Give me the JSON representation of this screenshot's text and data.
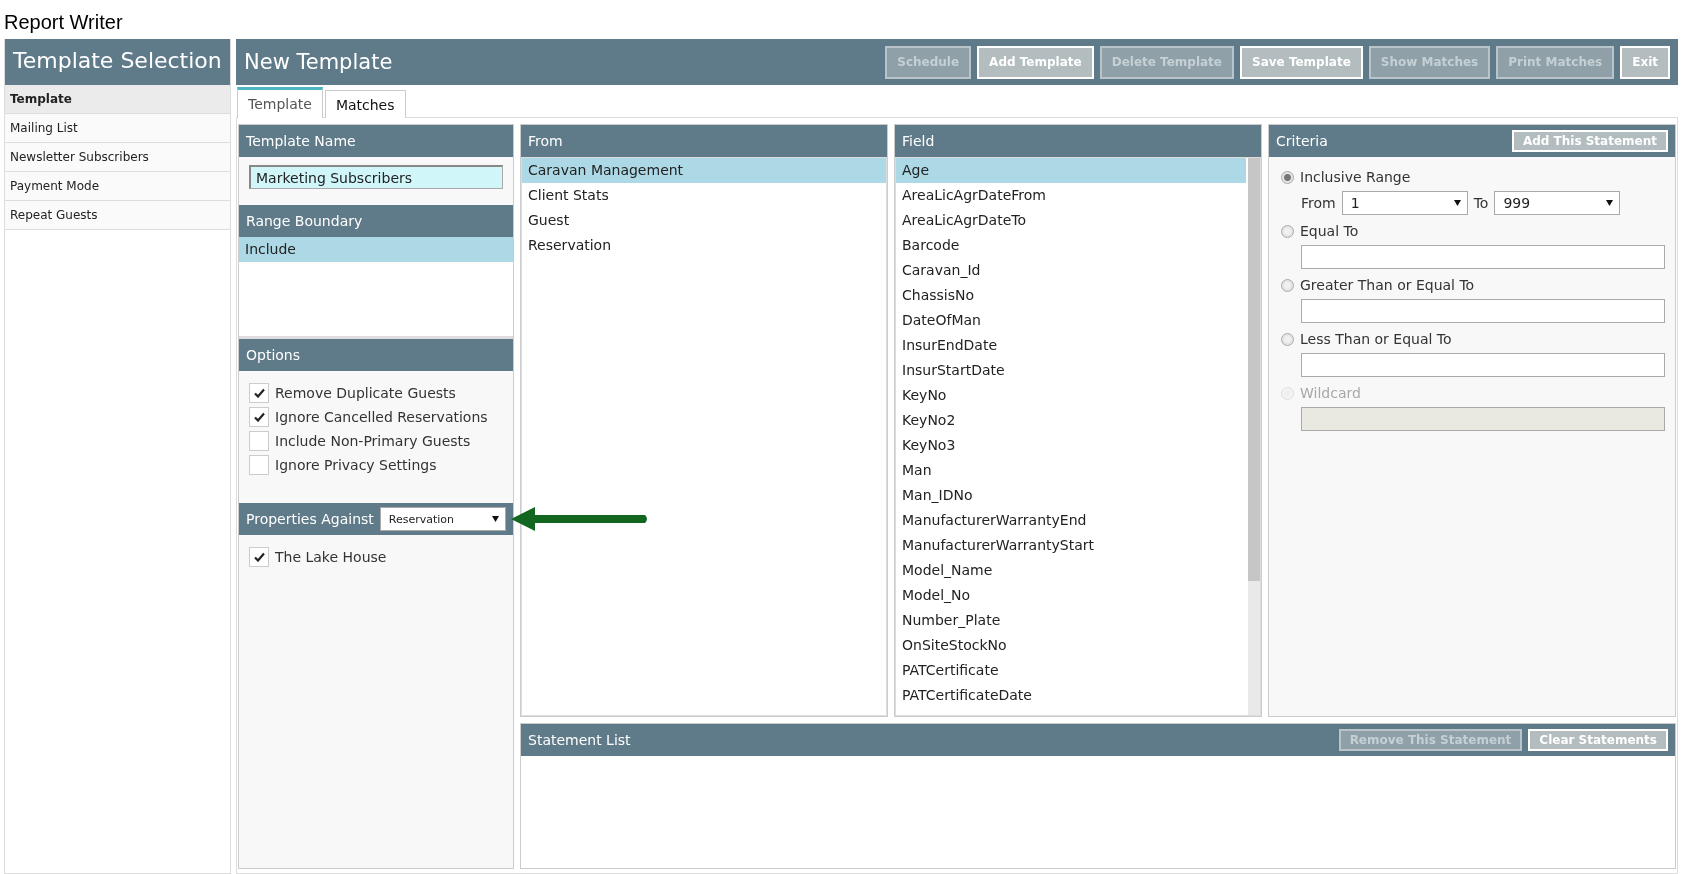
{
  "app_title": "Report Writer",
  "sidebar": {
    "title": "Template Selection",
    "items": [
      {
        "label": "Template",
        "selected": true
      },
      {
        "label": "Mailing List",
        "selected": false
      },
      {
        "label": "Newsletter Subscribers",
        "selected": false
      },
      {
        "label": "Payment Mode",
        "selected": false
      },
      {
        "label": "Repeat Guests",
        "selected": false
      }
    ]
  },
  "main": {
    "title": "New Template",
    "buttons": [
      {
        "label": "Schedule",
        "disabled": true
      },
      {
        "label": "Add Template",
        "disabled": false
      },
      {
        "label": "Delete Template",
        "disabled": true
      },
      {
        "label": "Save Template",
        "disabled": false
      },
      {
        "label": "Show Matches",
        "disabled": true
      },
      {
        "label": "Print Matches",
        "disabled": true
      },
      {
        "label": "Exit",
        "disabled": false
      }
    ]
  },
  "tabs": [
    {
      "label": "Template",
      "selected": true
    },
    {
      "label": "Matches",
      "selected": false
    }
  ],
  "template_name": {
    "heading": "Template Name",
    "value": "Marketing Subscribers"
  },
  "range_boundary": {
    "heading": "Range Boundary",
    "items": [
      {
        "label": "Include",
        "selected": true
      }
    ]
  },
  "options": {
    "heading": "Options",
    "items": [
      {
        "label": "Remove Duplicate Guests",
        "checked": true
      },
      {
        "label": "Ignore Cancelled Reservations",
        "checked": true
      },
      {
        "label": "Include Non-Primary Guests",
        "checked": false
      },
      {
        "label": "Ignore Privacy Settings",
        "checked": false
      }
    ]
  },
  "properties_against": {
    "heading": "Properties Against",
    "value": "Reservation",
    "items": [
      {
        "label": "The Lake House",
        "checked": true
      }
    ]
  },
  "from": {
    "heading": "From",
    "items": [
      {
        "label": "Caravan Management",
        "selected": true
      },
      {
        "label": "Client Stats",
        "selected": false
      },
      {
        "label": "Guest",
        "selected": false
      },
      {
        "label": "Reservation",
        "selected": false
      }
    ]
  },
  "field": {
    "heading": "Field",
    "items": [
      {
        "label": "Age",
        "selected": true
      },
      {
        "label": "AreaLicAgrDateFrom",
        "selected": false
      },
      {
        "label": "AreaLicAgrDateTo",
        "selected": false
      },
      {
        "label": "Barcode",
        "selected": false
      },
      {
        "label": "Caravan_Id",
        "selected": false
      },
      {
        "label": "ChassisNo",
        "selected": false
      },
      {
        "label": "DateOfMan",
        "selected": false
      },
      {
        "label": "InsurEndDate",
        "selected": false
      },
      {
        "label": "InsurStartDate",
        "selected": false
      },
      {
        "label": "KeyNo",
        "selected": false
      },
      {
        "label": "KeyNo2",
        "selected": false
      },
      {
        "label": "KeyNo3",
        "selected": false
      },
      {
        "label": "Man",
        "selected": false
      },
      {
        "label": "Man_IDNo",
        "selected": false
      },
      {
        "label": "ManufacturerWarrantyEnd",
        "selected": false
      },
      {
        "label": "ManufacturerWarrantyStart",
        "selected": false
      },
      {
        "label": "Model_Name",
        "selected": false
      },
      {
        "label": "Model_No",
        "selected": false
      },
      {
        "label": "Number_Plate",
        "selected": false
      },
      {
        "label": "OnSiteStockNo",
        "selected": false
      },
      {
        "label": "PATCertificate",
        "selected": false
      },
      {
        "label": "PATCertificateDate",
        "selected": false
      }
    ]
  },
  "criteria": {
    "heading": "Criteria",
    "button": {
      "label": "Add This Statement",
      "disabled": false
    },
    "options": [
      {
        "kind": "range",
        "label": "Inclusive Range",
        "selected": true,
        "disabled": false,
        "from_label": "From",
        "from_value": "1",
        "to_label": "To",
        "to_value": "999"
      },
      {
        "kind": "text",
        "label": "Equal To",
        "selected": false,
        "disabled": false
      },
      {
        "kind": "text",
        "label": "Greater Than or Equal To",
        "selected": false,
        "disabled": false
      },
      {
        "kind": "text",
        "label": "Less Than or Equal To",
        "selected": false,
        "disabled": false
      },
      {
        "kind": "text",
        "label": "Wildcard",
        "selected": false,
        "disabled": true
      }
    ]
  },
  "statement_list": {
    "heading": "Statement List",
    "buttons": [
      {
        "label": "Remove This Statement",
        "disabled": true
      },
      {
        "label": "Clear Statements",
        "disabled": false
      }
    ]
  }
}
